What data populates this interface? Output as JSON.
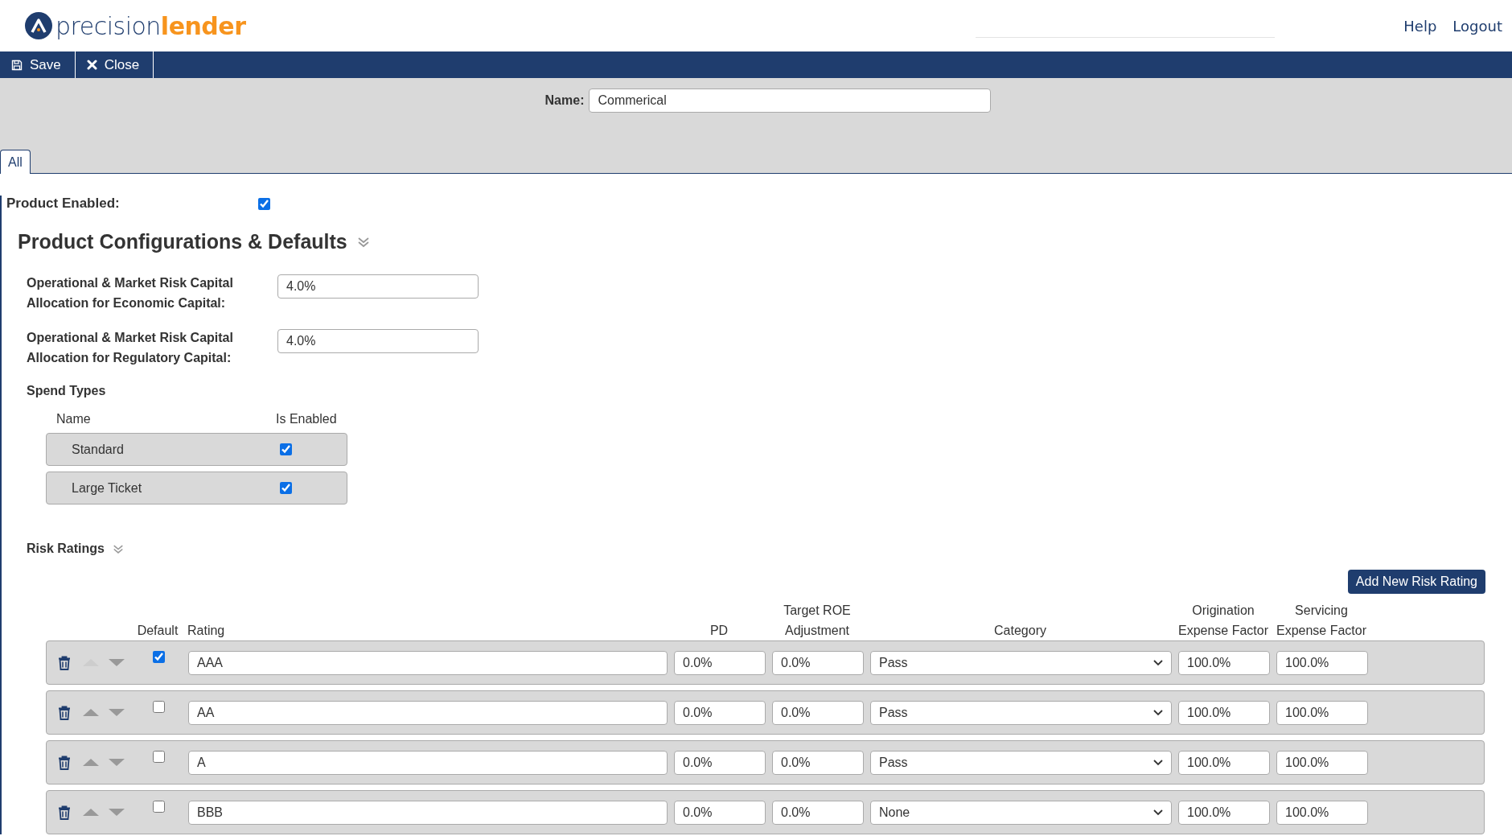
{
  "header": {
    "logo": {
      "part_1": "precision",
      "part_2": "lender"
    },
    "links": [
      "Help",
      "Logout"
    ]
  },
  "toolbar": {
    "buttons": [
      {
        "kind": "save",
        "label": "Save"
      },
      {
        "kind": "close",
        "label": "Close"
      }
    ]
  },
  "name_field": {
    "label": "Name:",
    "value": "Commerical"
  },
  "tabs": [
    {
      "label": "All",
      "selected": true
    }
  ],
  "product_enabled": {
    "label": "Product Enabled:",
    "checked": true
  },
  "section": {
    "title": "Product Configurations & Defaults",
    "expanded": true
  },
  "fields": [
    {
      "label": "Operational & Market Risk Capital Allocation for Economic Capital:",
      "value": "4.0%"
    },
    {
      "label": "Operational & Market Risk Capital Allocation for Regulatory Capital:",
      "value": "4.0%"
    }
  ],
  "spend_types": {
    "title": "Spend Types",
    "columns": [
      "Name",
      "Is Enabled"
    ],
    "rows": [
      {
        "name": "Standard",
        "checked": true
      },
      {
        "name": "Large Ticket",
        "checked": true
      }
    ]
  },
  "risk_ratings": {
    "title": "Risk Ratings",
    "expanded": true,
    "add_button": "Add New Risk Rating",
    "columns": [
      "Default",
      "Rating",
      "PD",
      "Target ROE Adjustment",
      "Category",
      "Origination Expense Factor",
      "Servicing Expense Factor"
    ],
    "rows": [
      {
        "default": true,
        "move_up_disabled": true,
        "rating": "AAA",
        "pd": "0.0%",
        "target_roe": "0.0%",
        "category": "Pass",
        "origination": "100.0%",
        "servicing": "100.0%"
      },
      {
        "default": false,
        "move_up_disabled": false,
        "rating": "AA",
        "pd": "0.0%",
        "target_roe": "0.0%",
        "category": "Pass",
        "origination": "100.0%",
        "servicing": "100.0%"
      },
      {
        "default": false,
        "move_up_disabled": false,
        "rating": "A",
        "pd": "0.0%",
        "target_roe": "0.0%",
        "category": "Pass",
        "origination": "100.0%",
        "servicing": "100.0%"
      },
      {
        "default": false,
        "move_up_disabled": false,
        "rating": "BBB",
        "pd": "0.0%",
        "target_roe": "0.0%",
        "category": "None",
        "origination": "100.0%",
        "servicing": "100.0%"
      }
    ]
  }
}
